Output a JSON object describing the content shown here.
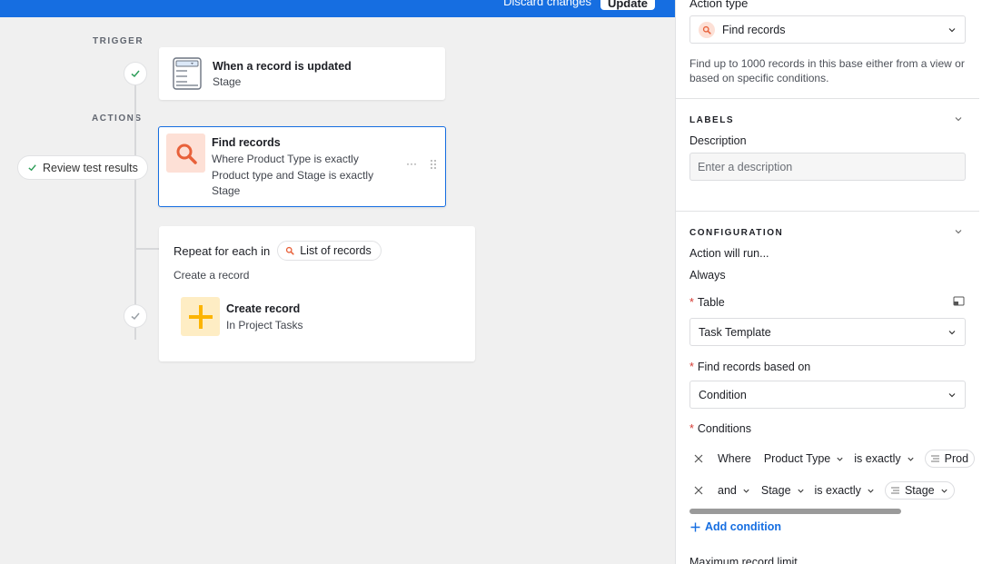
{
  "topbar": {
    "discard_label": "Discard changes",
    "update_label": "Update"
  },
  "canvas": {
    "trigger_label": "TRIGGER",
    "actions_label": "ACTIONS",
    "trigger_card": {
      "title": "When a record is updated",
      "subtitle": "Stage"
    },
    "find_card": {
      "title": "Find records",
      "line1": "Where Product Type is exactly",
      "line2": "Product type and Stage is exactly",
      "line3": "Stage",
      "more": "···"
    },
    "review_label": "Review test results",
    "repeat_card": {
      "title": "Repeat for each in",
      "chip_label": "List of records",
      "subtitle": "Create a record",
      "action_title": "Create record",
      "action_sub": "In Project Tasks"
    }
  },
  "panel": {
    "action_type_label": "Action type",
    "action_type_value": "Find records",
    "action_type_help": "Find up to 1000 records in this base either from a view or based on specific conditions.",
    "labels_head": "LABELS",
    "description_label": "Description",
    "description_placeholder": "Enter a description",
    "config_head": "CONFIGURATION",
    "will_run_label": "Action will run...",
    "will_run_value": "Always",
    "table_label": "Table",
    "table_value": "Task Template",
    "find_based_label": "Find records based on",
    "find_based_value": "Condition",
    "conditions_label": "Conditions",
    "conditions": [
      {
        "prefix": "Where",
        "field": "Product Type",
        "op": "is exactly",
        "value": "Prod"
      },
      {
        "prefix": "and",
        "field": "Stage",
        "op": "is exactly",
        "value": "Stage"
      }
    ],
    "add_condition_label": "Add condition",
    "max_limit_label": "Maximum record limit"
  },
  "colors": {
    "accent": "#166ee1",
    "search_orange": "#e8613a",
    "plus_yellow": "#fcb400",
    "required_red": "#d43a33"
  }
}
